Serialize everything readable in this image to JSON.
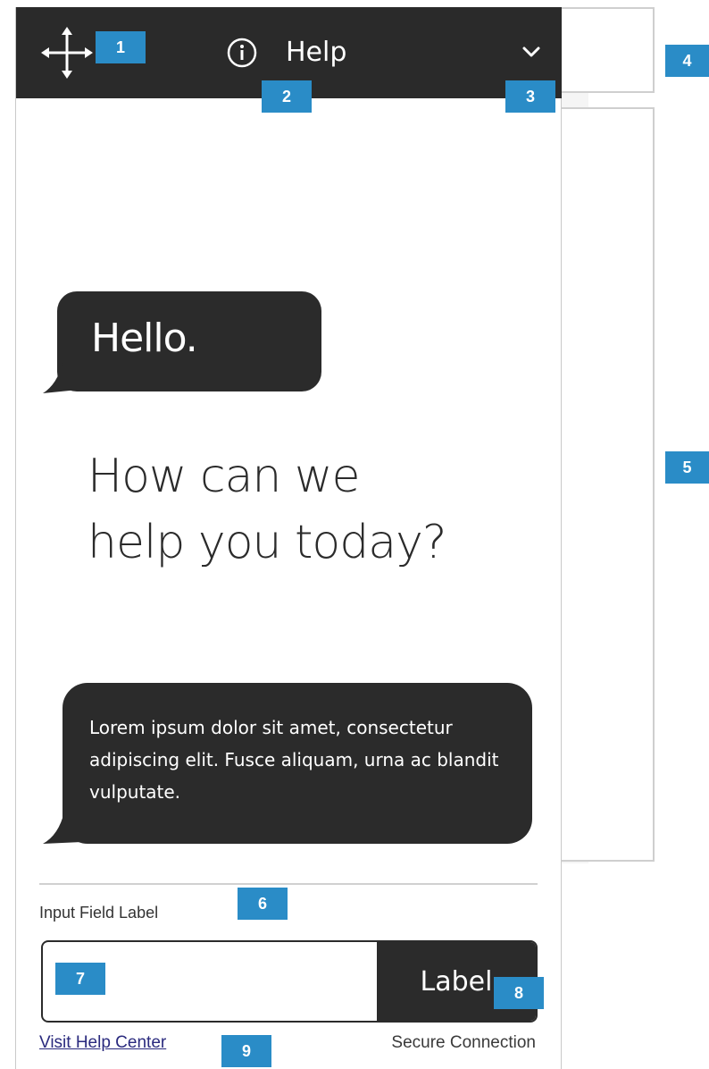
{
  "header": {
    "title": "Help",
    "move_icon": "move-arrows-icon",
    "info_icon": "info-circle-icon",
    "collapse_icon": "chevron-down-icon",
    "background": "#2a2a2a"
  },
  "chat": {
    "greeting": "Hello.",
    "headline_line1": "How can we",
    "headline_line2": "help you today?",
    "message": "Lorem ipsum dolor sit amet, consectetur adipiscing elit. Fusce aliquam, urna ac blandit vulputate."
  },
  "form": {
    "field_label": "Input Field Label",
    "input_value": "",
    "button_label": "Label"
  },
  "footer": {
    "help_link": "Visit Help Center",
    "secure_text": "Secure Connection"
  },
  "badges": {
    "b1": "1",
    "b2": "2",
    "b3": "3",
    "b4": "4",
    "b5": "5",
    "b6": "6",
    "b7": "7",
    "b8": "8",
    "b9": "9"
  },
  "colors": {
    "badge": "#2a8cc7",
    "bubble": "#2b2b2b",
    "link": "#2a2a7e"
  }
}
